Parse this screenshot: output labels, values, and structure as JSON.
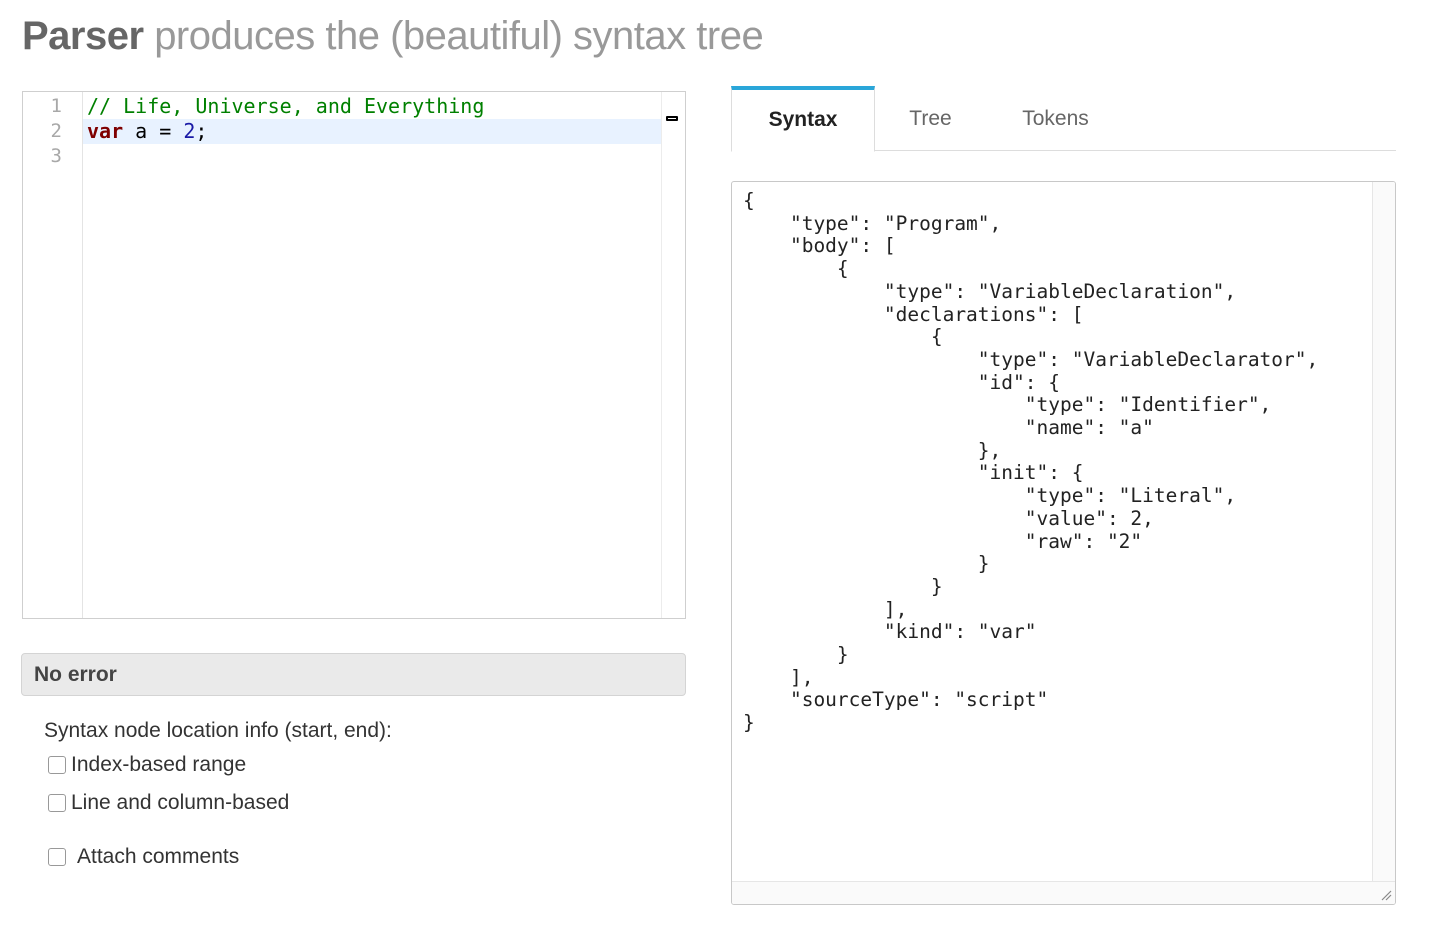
{
  "header": {
    "title_bold": "Parser",
    "title_rest": "produces the (beautiful) syntax tree"
  },
  "editor": {
    "line_numbers": [
      "1",
      "2",
      "3"
    ],
    "line1_comment": "// Life, Universe, and Everything",
    "line2_keyword": "var",
    "line2_mid": " a = ",
    "line2_number": "2",
    "line2_end": ";",
    "line3": ""
  },
  "status": {
    "message": "No error"
  },
  "options": {
    "location_label": "Syntax node location info (start, end):",
    "index_range_label": "Index-based range",
    "index_range_checked": false,
    "line_column_label": "Line and column-based",
    "line_column_checked": false,
    "attach_comments_label": "Attach comments",
    "attach_comments_checked": false
  },
  "tabs": [
    {
      "label": "Syntax",
      "active": true
    },
    {
      "label": "Tree",
      "active": false
    },
    {
      "label": "Tokens",
      "active": false
    }
  ],
  "output": {
    "syntax_json": "{\n    \"type\": \"Program\",\n    \"body\": [\n        {\n            \"type\": \"VariableDeclaration\",\n            \"declarations\": [\n                {\n                    \"type\": \"VariableDeclarator\",\n                    \"id\": {\n                        \"type\": \"Identifier\",\n                        \"name\": \"a\"\n                    },\n                    \"init\": {\n                        \"type\": \"Literal\",\n                        \"value\": 2,\n                        \"raw\": \"2\"\n                    }\n                }\n            ],\n            \"kind\": \"var\"\n        }\n    ],\n    \"sourceType\": \"script\"\n}"
  },
  "colors": {
    "comment": "#008000",
    "keyword": "#7f0000",
    "number": "#1a1aa6",
    "active_line": "#e8f2ff",
    "tab_accent": "#2aa6d9"
  }
}
